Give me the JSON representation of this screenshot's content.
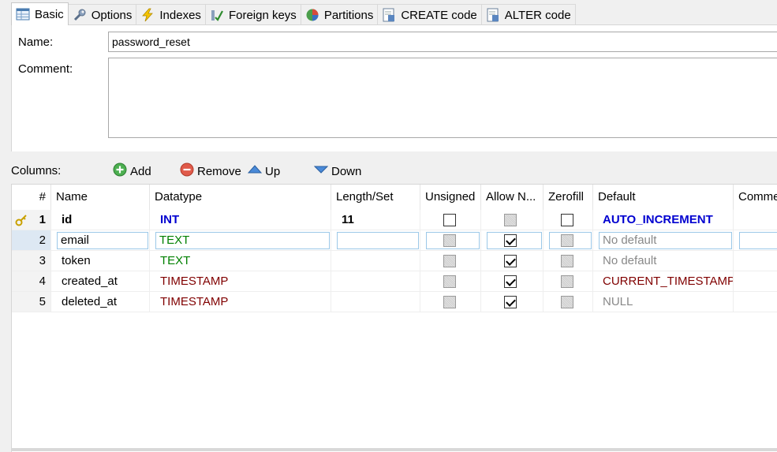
{
  "tabs": [
    {
      "label": "Basic",
      "icon": "table-icon",
      "active": true
    },
    {
      "label": "Options",
      "icon": "wrench-icon"
    },
    {
      "label": "Indexes",
      "icon": "lightning-icon"
    },
    {
      "label": "Foreign keys",
      "icon": "foreign-key-icon"
    },
    {
      "label": "Partitions",
      "icon": "pie-icon"
    },
    {
      "label": "CREATE code",
      "icon": "code-icon"
    },
    {
      "label": "ALTER code",
      "icon": "code-icon"
    }
  ],
  "form": {
    "name_label": "Name:",
    "name_value": "password_reset",
    "comment_label": "Comment:",
    "comment_value": ""
  },
  "toolbar": {
    "columns_label": "Columns:",
    "add_label": "Add",
    "remove_label": "Remove",
    "up_label": "Up",
    "down_label": "Down"
  },
  "grid": {
    "headers": [
      "#",
      "Name",
      "Datatype",
      "Length/Set",
      "Unsigned",
      "Allow N...",
      "Zerofill",
      "Default",
      "Comme"
    ],
    "rows": [
      {
        "num": "1",
        "name": "id",
        "type": "INT",
        "length": "11",
        "unsigned": "empty",
        "allow_null": "grey",
        "zerofill": "empty",
        "default": "AUTO_INCREMENT",
        "primary_key": true
      },
      {
        "num": "2",
        "name": "email",
        "type": "TEXT",
        "length": "",
        "unsigned": "grey",
        "allow_null": "checked",
        "zerofill": "grey",
        "default": "No default",
        "selected": true
      },
      {
        "num": "3",
        "name": "token",
        "type": "TEXT",
        "length": "",
        "unsigned": "grey",
        "allow_null": "checked",
        "zerofill": "grey",
        "default": "No default"
      },
      {
        "num": "4",
        "name": "created_at",
        "type": "TIMESTAMP",
        "length": "",
        "unsigned": "grey",
        "allow_null": "checked",
        "zerofill": "grey",
        "default": "CURRENT_TIMESTAMP"
      },
      {
        "num": "5",
        "name": "deleted_at",
        "type": "TIMESTAMP",
        "length": "",
        "unsigned": "grey",
        "allow_null": "checked",
        "zerofill": "grey",
        "default": "NULL"
      }
    ]
  },
  "colors": {
    "blue": "#0000d0",
    "green": "#008000",
    "maroon": "#800000",
    "grey": "#888888"
  }
}
